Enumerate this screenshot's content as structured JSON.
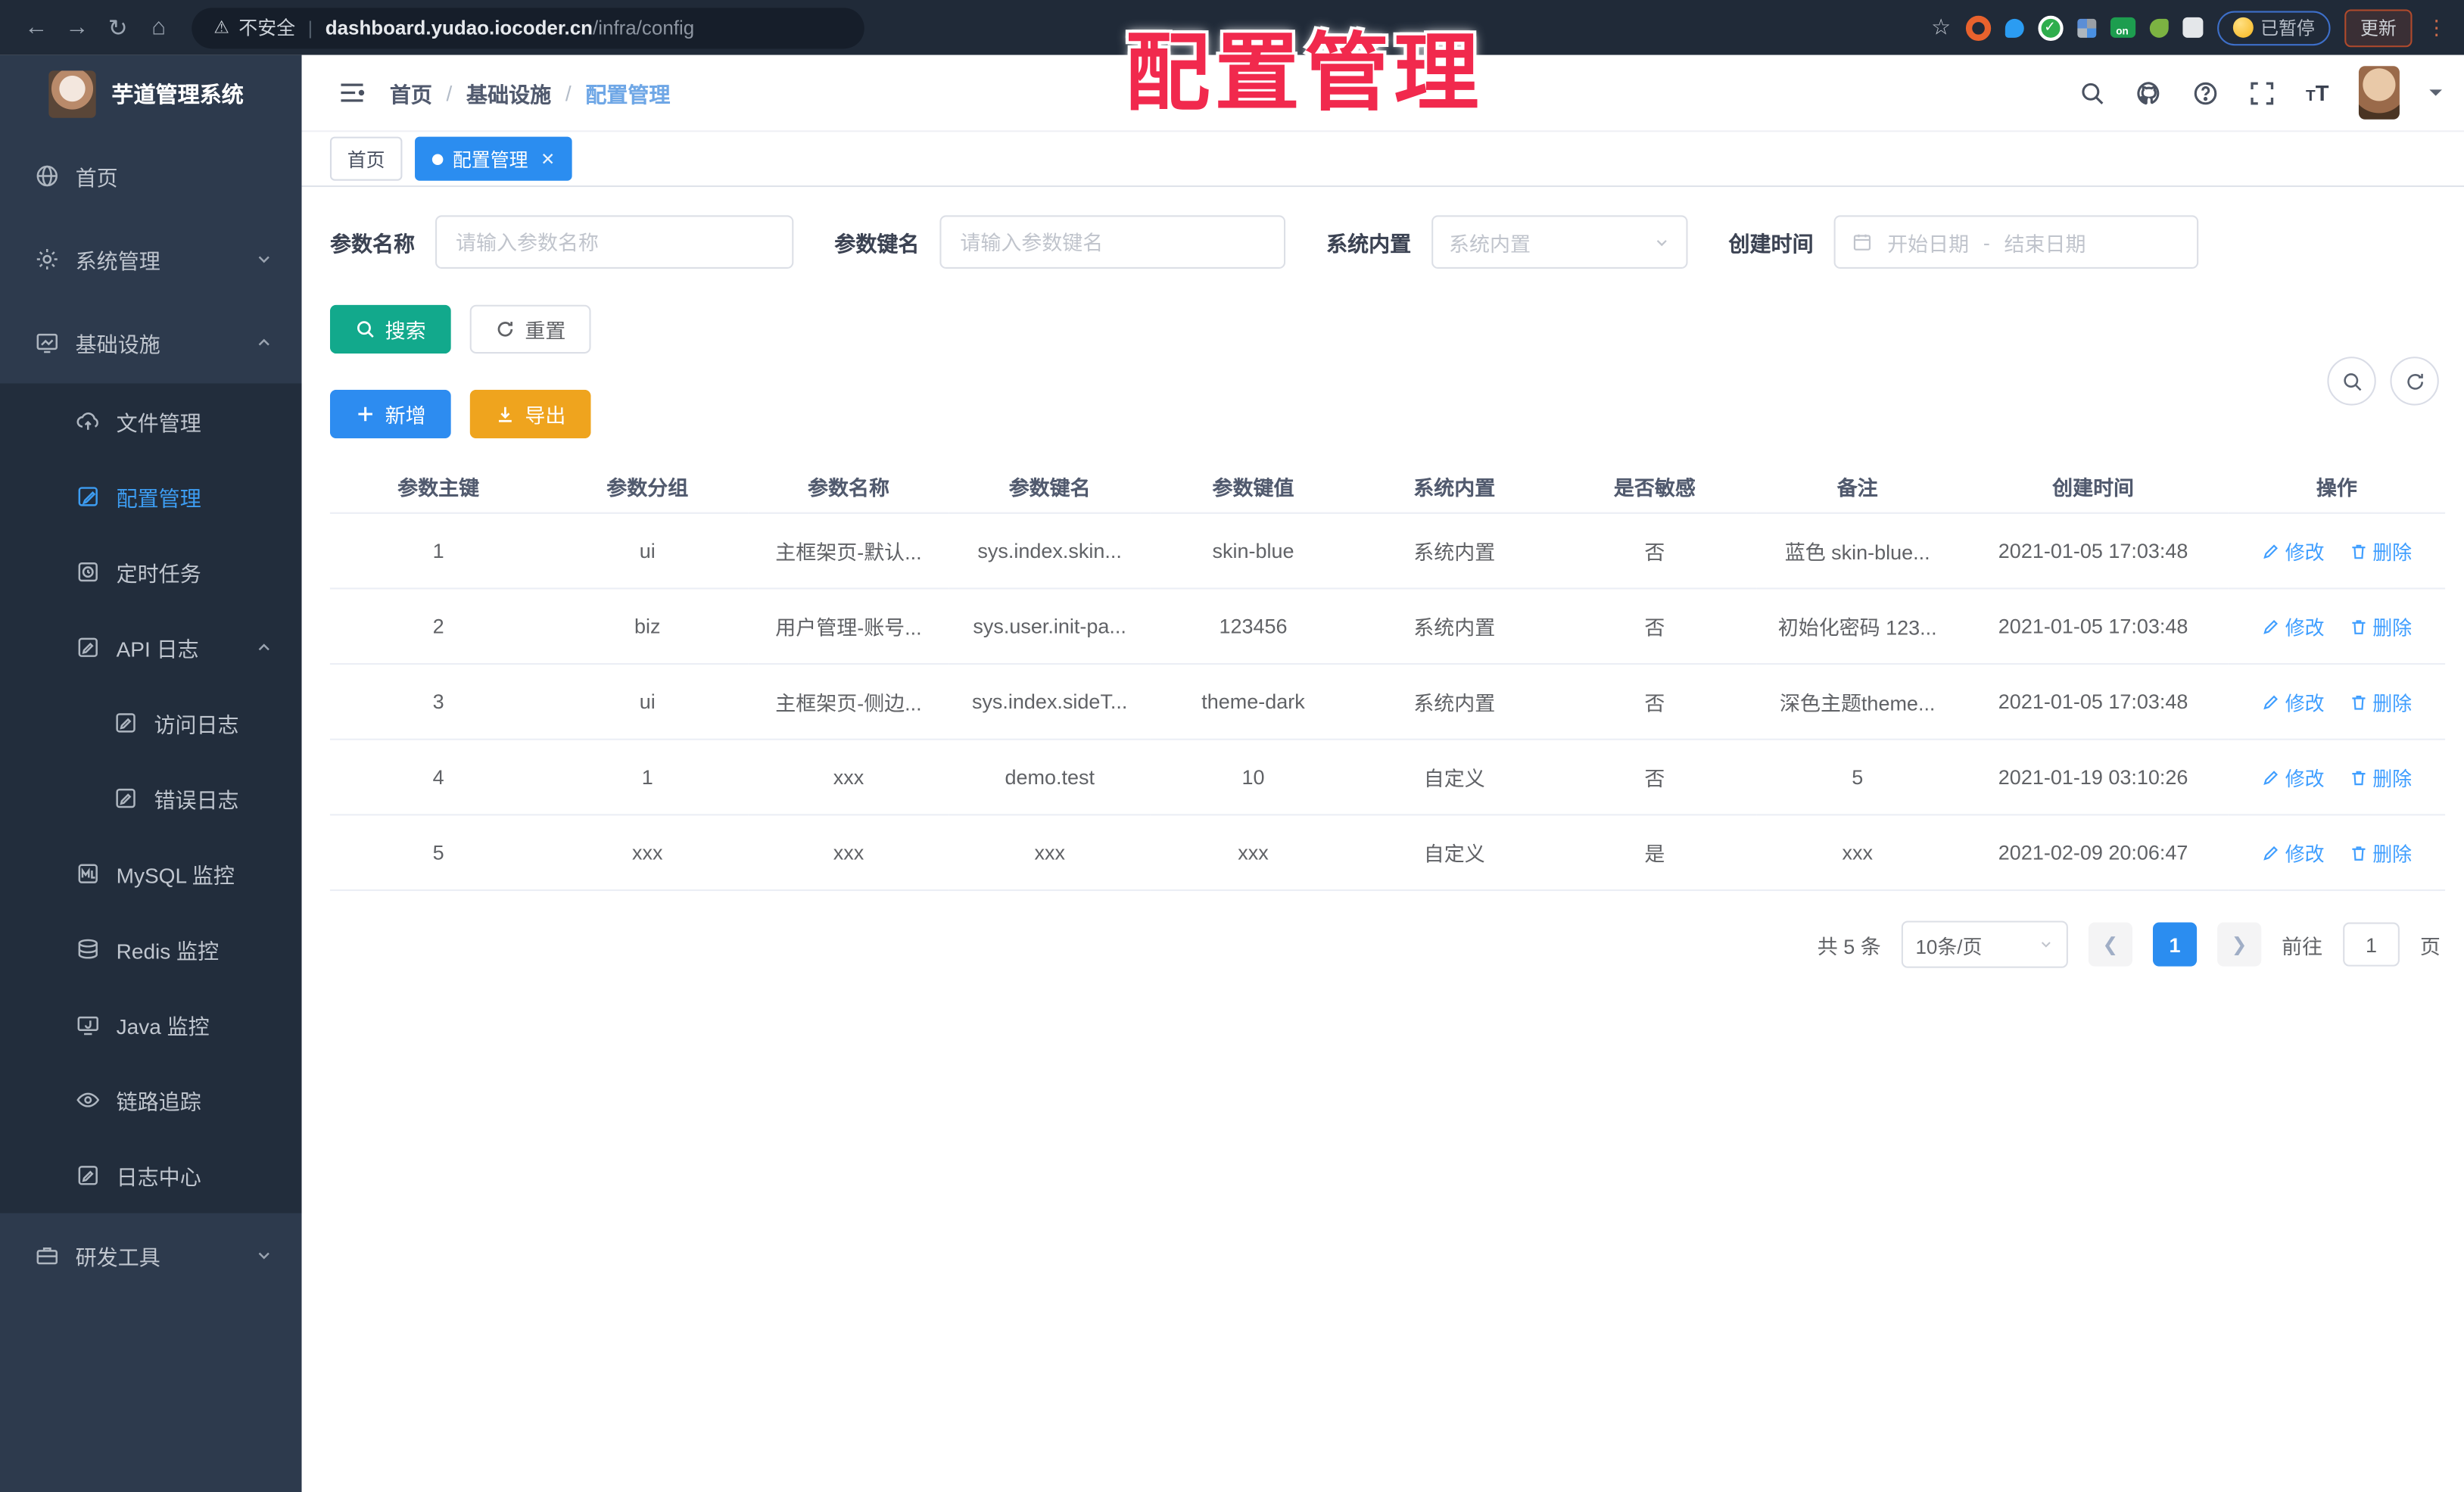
{
  "watermark": "配置管理",
  "colors": {
    "primary": "#2b8df0",
    "teal": "#12a98c",
    "orange": "#efa41e",
    "watermark_red": "#f1294d",
    "sidebar_bg": "#2d3a4d",
    "submenu_bg": "#222d3c"
  },
  "browser": {
    "security_label": "不安全",
    "url_domain": "dashboard.yudao.iocoder.cn",
    "url_path": "/infra/config",
    "ext_on_label": "on",
    "paused_badge": "已暂停",
    "update_button": "更新"
  },
  "sidebar": {
    "app_title": "芋道管理系统",
    "items": [
      {
        "label": "首页"
      },
      {
        "label": "系统管理"
      },
      {
        "label": "基础设施"
      },
      {
        "label": "文件管理"
      },
      {
        "label": "配置管理"
      },
      {
        "label": "定时任务"
      },
      {
        "label": "API 日志"
      },
      {
        "label": "访问日志"
      },
      {
        "label": "错误日志"
      },
      {
        "label": "MySQL 监控"
      },
      {
        "label": "Redis 监控"
      },
      {
        "label": "Java 监控"
      },
      {
        "label": "链路追踪"
      },
      {
        "label": "日志中心"
      },
      {
        "label": "研发工具"
      }
    ]
  },
  "breadcrumb": {
    "home": "首页",
    "section": "基础设施",
    "current": "配置管理"
  },
  "tabs": {
    "home": "首页",
    "current": "配置管理"
  },
  "filters": {
    "name_label": "参数名称",
    "name_placeholder": "请输入参数名称",
    "key_label": "参数键名",
    "key_placeholder": "请输入参数键名",
    "type_label": "系统内置",
    "type_placeholder": "系统内置",
    "date_label": "创建时间",
    "date_start": "开始日期",
    "date_sep": "-",
    "date_end": "结束日期"
  },
  "actions": {
    "search": "搜索",
    "reset": "重置",
    "add": "新增",
    "export": "导出"
  },
  "table": {
    "columns": [
      "参数主键",
      "参数分组",
      "参数名称",
      "参数键名",
      "参数键值",
      "系统内置",
      "是否敏感",
      "备注",
      "创建时间",
      "操作"
    ],
    "edit_label": "修改",
    "delete_label": "删除",
    "rows": [
      {
        "id": "1",
        "group": "ui",
        "name": "主框架页-默认...",
        "key": "sys.index.skin...",
        "value": "skin-blue",
        "type": "系统内置",
        "sensitive": "否",
        "remark": "蓝色 skin-blue...",
        "created": "2021-01-05 17:03:48"
      },
      {
        "id": "2",
        "group": "biz",
        "name": "用户管理-账号...",
        "key": "sys.user.init-pa...",
        "value": "123456",
        "type": "系统内置",
        "sensitive": "否",
        "remark": "初始化密码 123...",
        "created": "2021-01-05 17:03:48"
      },
      {
        "id": "3",
        "group": "ui",
        "name": "主框架页-侧边...",
        "key": "sys.index.sideT...",
        "value": "theme-dark",
        "type": "系统内置",
        "sensitive": "否",
        "remark": "深色主题theme...",
        "created": "2021-01-05 17:03:48"
      },
      {
        "id": "4",
        "group": "1",
        "name": "xxx",
        "key": "demo.test",
        "value": "10",
        "type": "自定义",
        "sensitive": "否",
        "remark": "5",
        "created": "2021-01-19 03:10:26"
      },
      {
        "id": "5",
        "group": "xxx",
        "name": "xxx",
        "key": "xxx",
        "value": "xxx",
        "type": "自定义",
        "sensitive": "是",
        "remark": "xxx",
        "created": "2021-02-09 20:06:47"
      }
    ]
  },
  "pagination": {
    "total": "共 5 条",
    "page_size": "10条/页",
    "current_page": "1",
    "goto_label": "前往",
    "goto_value": "1",
    "page_unit": "页"
  }
}
